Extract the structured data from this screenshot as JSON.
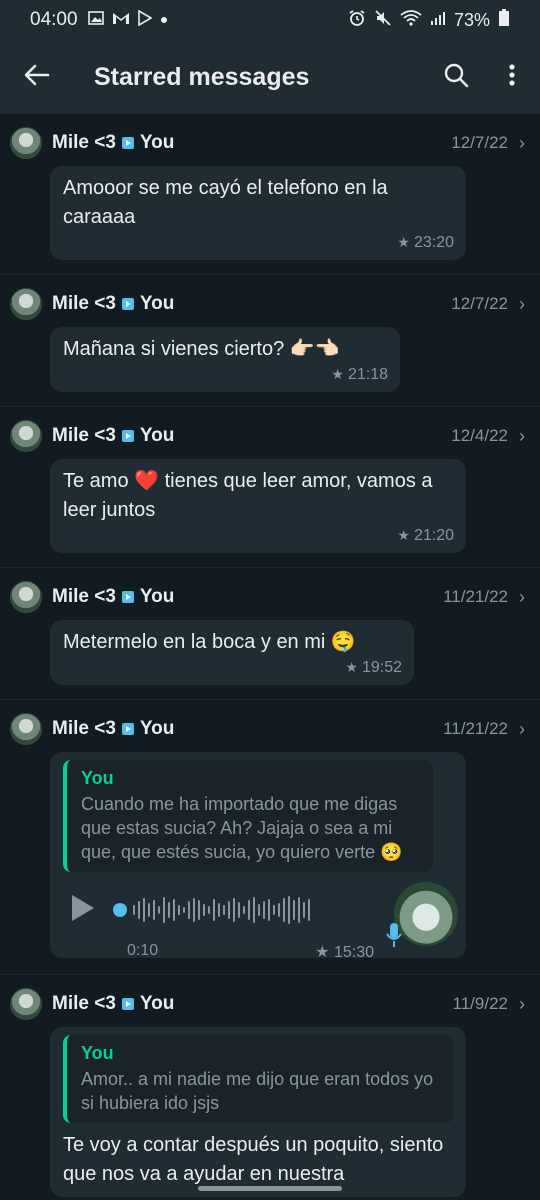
{
  "status_bar": {
    "time": "04:00",
    "battery": "73%",
    "left_icons": [
      "image-icon",
      "gmail-icon",
      "play-store-icon",
      "dot-icon"
    ],
    "right_icons": [
      "alarm-icon",
      "mute-icon",
      "wifi-icon",
      "signal-icon",
      "battery-icon"
    ]
  },
  "appbar": {
    "title": "Starred messages",
    "back_icon": "arrow-back-icon",
    "search_icon": "search-icon",
    "menu_icon": "more-vert-icon"
  },
  "colors": {
    "background": "#111b21",
    "bar": "#1f2c34",
    "bubble": "#202c33",
    "accent_green": "#06cf9c",
    "accent_blue": "#53bdeb",
    "muted": "#8696a0"
  },
  "items": [
    {
      "sender": "Mile <3",
      "recipient": "You",
      "date": "12/7/22",
      "text": "Amooor se me cayó el telefono en la caraaaa",
      "time": "23:20"
    },
    {
      "sender": "Mile <3",
      "recipient": "You",
      "date": "12/7/22",
      "text": "Mañana si vienes cierto? 👉🏻👈🏻",
      "time": "21:18"
    },
    {
      "sender": "Mile <3",
      "recipient": "You",
      "date": "12/4/22",
      "text": "Te amo ❤️ tienes que leer amor, vamos a leer juntos",
      "time": "21:20"
    },
    {
      "sender": "Mile <3",
      "recipient": "You",
      "date": "11/21/22",
      "text": "Metermelo en la boca y en mi 🤤",
      "time": "19:52"
    },
    {
      "sender": "Mile <3",
      "recipient": "You",
      "date": "11/21/22",
      "quote_name": "You",
      "quote_text": "Cuando me ha importado que me digas que estas sucia? Ah? Jajaja o sea a mi que, que estés sucia, yo quiero verte 🥺",
      "voice_duration": "0:10",
      "time": "15:30"
    },
    {
      "sender": "Mile <3",
      "recipient": "You",
      "date": "11/9/22",
      "quote_name": "You",
      "quote_text": "Amor.. a mi nadie me dijo que eran todos yo si hubiera ido jsjs",
      "text": "Te voy a contar después un poquito, siento que nos va a ayudar en nuestra"
    }
  ]
}
